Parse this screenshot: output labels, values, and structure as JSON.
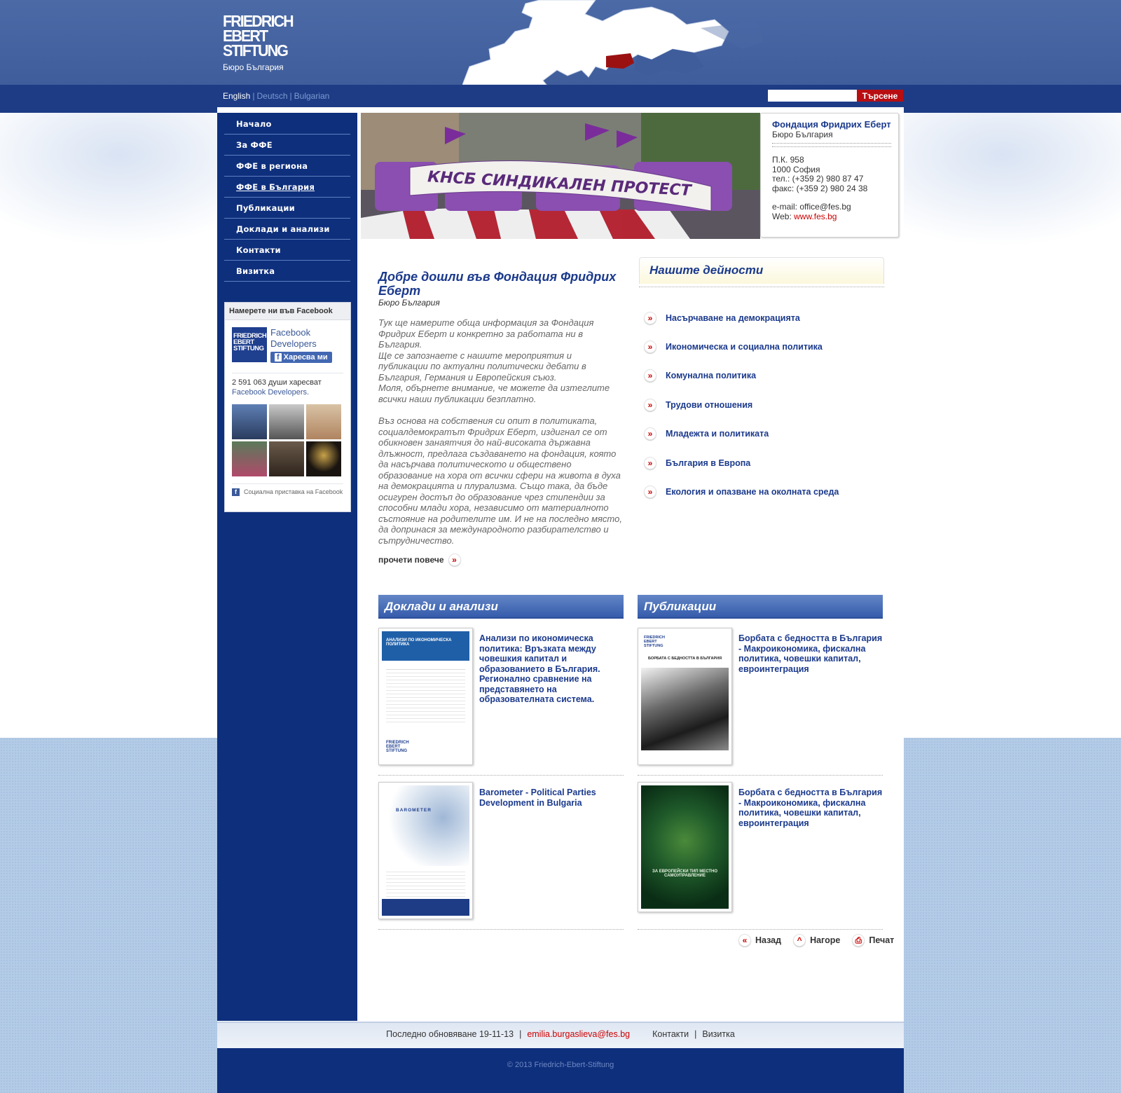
{
  "header": {
    "logo_lines": [
      "FRIEDRICH",
      "EBERT",
      "STIFTUNG"
    ],
    "logo_subtitle": "Бюро България",
    "languages": [
      "English",
      "Deutsch",
      "Bulgarian"
    ],
    "active_language": "English",
    "search": {
      "placeholder": "",
      "button_label": "Търсене"
    }
  },
  "nav": {
    "items": [
      "Начало",
      "За ФФЕ",
      "ФФЕ в региона",
      "ФФЕ в България",
      "Публикации",
      "Доклади и анализи",
      "Контакти",
      "Визитка"
    ],
    "current": "ФФЕ в България"
  },
  "facebook": {
    "heading": "Намерете ни във Facebook",
    "page_name": "Facebook Developers",
    "like_label": "Харесва ми",
    "count_text": "2 591 063 души харесват",
    "count_link": "Facebook Developers.",
    "plugin_text": "Социална приставка на Facebook"
  },
  "banner": {
    "text": "КНСБ СИНДИКАЛЕН ПРОТЕСТ"
  },
  "contact_card": {
    "title": "Фондация Фридрих Еберт",
    "subtitle": "Бюро България",
    "lines": [
      "П.К. 958",
      "1000 София",
      "тел.: (+359 2) 980 87 47",
      "факс: (+359 2) 980 24 38"
    ],
    "email": "e-mail: office@fes.bg",
    "web_label": "Web: ",
    "web_link": "www.fes.bg"
  },
  "welcome": {
    "title": "Добре дошли във Фондация Фридрих Еберт",
    "subtitle": "Бюро България",
    "paragraph1": "Тук ще намерите обща информация за Фондация Фридрих Еберт и конкретно за работата ни в България.\nЩе се запознаете с нашите мероприятия и публикации по актуални политически дебати в България, Германия и Европейския съюз.\nМоля, обърнете внимание, че можете да изтеглите всички наши публикации безплатно.",
    "paragraph2": "Въз основа на собствения си опит в политиката, социалдемократът Фридрих Еберт, издигнал се от обикновен занаятчия до най-високата държавна длъжност, предлага създаването на фондация, която да насърчава политическото и обществено образование на хора от всички сфери на живота в духа на демокрацията и плурализма. Също така, да бъде осигурен достъп до образование чрез стипендии за способни млади хора, независимо от материалното състояние на родителите им. И не на последно място, да допринася за международното разбирателство и сътрудничество.",
    "read_more": "прочети повече"
  },
  "activities": {
    "title": "Нашите дейности",
    "items": [
      "Насърчаване на демокрацията",
      "Икономическа и социална политика",
      "Комунална политика",
      "Трудови отношения",
      "Младежта и политиката",
      "България в Европа",
      "Екология и опазване на околната среда"
    ]
  },
  "reports": {
    "title": "Доклади и анализи",
    "items": [
      {
        "title": "Анализи по икономическа политика: Връзката между човешкия капитал и образованието в България. Регионално сравнение на представянето на образователната система.",
        "cover_text": "АНАЛИЗИ ПО ИКОНОМИЧЕСКА ПОЛИТИКА"
      },
      {
        "title": "Barometer - Political Parties Development in Bulgaria",
        "cover_text": "BAROMETER"
      }
    ]
  },
  "publications": {
    "title": "Публикации",
    "items": [
      {
        "title": "Борбата с бедността в България - Макроикономика, фискална политика, човешки капитал, евроинтеграция",
        "cover_text": "БОРБАТА С БЕДНОСТТА В БЪЛГАРИЯ"
      },
      {
        "title": "Борбата с бедността в България - Макроикономика, фискална политика, човешки капитал, евроинтеграция",
        "cover_text": "ЗА ЕВРОПЕЙСКИ ТИП МЕСТНО САМОУПРАВЛЕНИЕ"
      }
    ]
  },
  "tools": {
    "back": "Назад",
    "top": "Нагоре",
    "print": "Печат"
  },
  "footer": {
    "updated": "Последно обновяване 19-11-13",
    "email": "emilia.burgaslieva@fes.bg",
    "contacts": "Контакти",
    "card": "Визитка",
    "copyright": "© 2013 Friedrich-Ebert-Stiftung"
  },
  "colors": {
    "header_blue": "#4b6aa6",
    "nav_blue": "#0e2f7c",
    "accent_red": "#b80e12",
    "title_blue": "#1b3a8c"
  }
}
